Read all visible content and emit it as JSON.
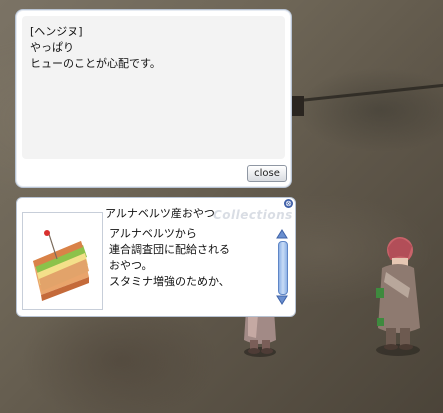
{
  "dialog": {
    "lines": [
      "[ヘンジヌ]",
      "やっぱり",
      "ヒューのことが心配です。"
    ],
    "close_label": "close"
  },
  "item_window": {
    "title": "アルナベルツ産おやつ",
    "watermark": "Collections",
    "description_lines": [
      "アルナベルツから",
      "連合調査団に配給される",
      "おやつ。",
      "スタミナ増強のためか、"
    ],
    "close_icon": "⊗"
  }
}
